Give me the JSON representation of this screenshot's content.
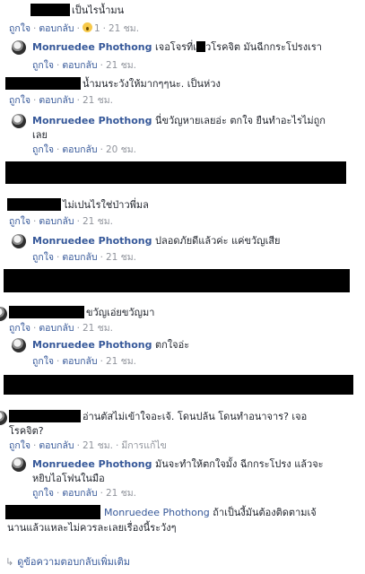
{
  "actions": {
    "like": "ถูกใจ",
    "reply": "ตอบกลับ",
    "edited": "มีการแก้ไข"
  },
  "c1": {
    "text": "เป็นไรน้ำมน",
    "reactions": "1",
    "time": "21 ชม."
  },
  "r1": {
    "name": "Monruedee Phothong",
    "text": "เจอโจรที่เ",
    "text_b": "วโรคจิต มันฉีกกระโปรงเรา",
    "time": "21 ชม."
  },
  "c2": {
    "text": "น้ำมนระวังให้มากๆๆนะ. เป็นห่วง",
    "time": "21 ชม."
  },
  "r2": {
    "name": "Monruedee Phothong",
    "text": "นี่ขวัญหายเลยอ่ะ ตกใจ ยืนทำอะไรไม่ถูก",
    "text2": "เลย",
    "time": "20 ชม."
  },
  "c3": {
    "text": "ไม่เปนไรใช่ป่าวพี่มล",
    "time": "21 ชม."
  },
  "r3": {
    "name": "Monruedee Phothong",
    "text": "ปลอดภัยดีแล้วค่ะ แค่ขวัญเสีย",
    "time": "21 ชม."
  },
  "c4": {
    "text": "ขวัญเอ่ยขวัญมา",
    "time": "21 ชม."
  },
  "r4": {
    "name": "Monruedee Phothong",
    "text": "ตกใจอ่ะ",
    "time": "21 ชม."
  },
  "c5": {
    "text": "อ่านตัสไม่เข้าใจอะเจ้. โดนปล้น โดนทำอนาจาร? เจอ",
    "text2": "โรคจิต?",
    "time": "21 ชม."
  },
  "r5": {
    "name": "Monruedee Phothong",
    "text": "มันจะทำให้ตกใจมั้ง ฉีกกระโปรง แล้วจะ",
    "text2": "หยิบไอโฟนในมือ",
    "time": "21 ชม."
  },
  "c6": {
    "name": "Monruedee Phothong",
    "text": "ถ้าเป็นงี้มันต้องติดตามเจ้",
    "text2": "นานแล้วแหละไม่ควรละเลยเรื่องนี้ระวังๆ"
  },
  "more_replies": "ดูข้อความตอบกลับเพิ่มเติม"
}
